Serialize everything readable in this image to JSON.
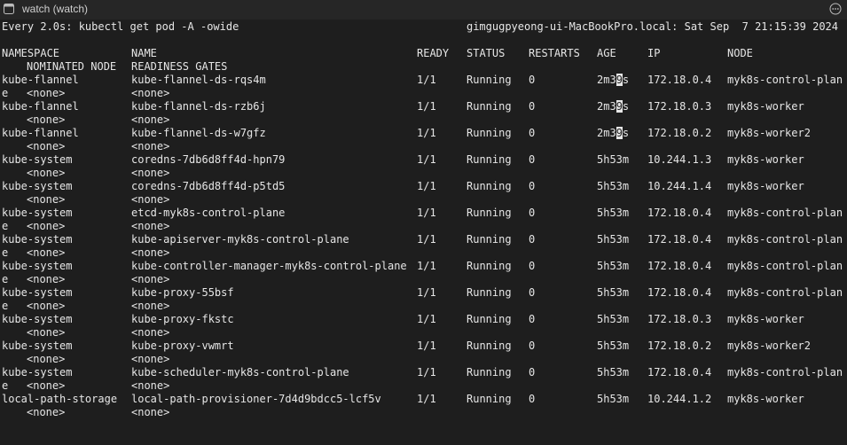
{
  "window": {
    "title": "watch (watch)"
  },
  "header": {
    "command": "Every 2.0s: kubectl get pod -A -owide",
    "host_time": "gimgugpyeong-ui-MacBookPro.local: Sat Sep  7 21:15:39 2024"
  },
  "columns": {
    "namespace": "NAMESPACE",
    "name": "NAME",
    "ready": "READY",
    "status": "STATUS",
    "restarts": "RESTARTS",
    "age": "AGE",
    "ip": "IP",
    "node": "NODE",
    "nominated_node": "NOMINATED NODE",
    "readiness_gates": "READINESS GATES"
  },
  "pods": [
    {
      "namespace": "kube-flannel",
      "name": "kube-flannel-ds-rqs4m",
      "ready": "1/1",
      "status": "Running",
      "restarts": "0",
      "age": "2m39s",
      "ip": "172.18.0.4",
      "node": "myk8s-control-plan",
      "wrap": "e",
      "nominated": "<none>",
      "gates": "<none>"
    },
    {
      "namespace": "kube-flannel",
      "name": "kube-flannel-ds-rzb6j",
      "ready": "1/1",
      "status": "Running",
      "restarts": "0",
      "age": "2m39s",
      "ip": "172.18.0.3",
      "node": "myk8s-worker",
      "wrap": "",
      "nominated": "<none>",
      "gates": "<none>"
    },
    {
      "namespace": "kube-flannel",
      "name": "kube-flannel-ds-w7gfz",
      "ready": "1/1",
      "status": "Running",
      "restarts": "0",
      "age": "2m39s",
      "ip": "172.18.0.2",
      "node": "myk8s-worker2",
      "wrap": "",
      "nominated": "<none>",
      "gates": "<none>"
    },
    {
      "namespace": "kube-system",
      "name": "coredns-7db6d8ff4d-hpn79",
      "ready": "1/1",
      "status": "Running",
      "restarts": "0",
      "age": "5h53m",
      "ip": "10.244.1.3",
      "node": "myk8s-worker",
      "wrap": "",
      "nominated": "<none>",
      "gates": "<none>"
    },
    {
      "namespace": "kube-system",
      "name": "coredns-7db6d8ff4d-p5td5",
      "ready": "1/1",
      "status": "Running",
      "restarts": "0",
      "age": "5h53m",
      "ip": "10.244.1.4",
      "node": "myk8s-worker",
      "wrap": "",
      "nominated": "<none>",
      "gates": "<none>"
    },
    {
      "namespace": "kube-system",
      "name": "etcd-myk8s-control-plane",
      "ready": "1/1",
      "status": "Running",
      "restarts": "0",
      "age": "5h53m",
      "ip": "172.18.0.4",
      "node": "myk8s-control-plan",
      "wrap": "e",
      "nominated": "<none>",
      "gates": "<none>"
    },
    {
      "namespace": "kube-system",
      "name": "kube-apiserver-myk8s-control-plane",
      "ready": "1/1",
      "status": "Running",
      "restarts": "0",
      "age": "5h53m",
      "ip": "172.18.0.4",
      "node": "myk8s-control-plan",
      "wrap": "e",
      "nominated": "<none>",
      "gates": "<none>"
    },
    {
      "namespace": "kube-system",
      "name": "kube-controller-manager-myk8s-control-plane",
      "ready": "1/1",
      "status": "Running",
      "restarts": "0",
      "age": "5h53m",
      "ip": "172.18.0.4",
      "node": "myk8s-control-plan",
      "wrap": "e",
      "nominated": "<none>",
      "gates": "<none>"
    },
    {
      "namespace": "kube-system",
      "name": "kube-proxy-55bsf",
      "ready": "1/1",
      "status": "Running",
      "restarts": "0",
      "age": "5h53m",
      "ip": "172.18.0.4",
      "node": "myk8s-control-plan",
      "wrap": "e",
      "nominated": "<none>",
      "gates": "<none>"
    },
    {
      "namespace": "kube-system",
      "name": "kube-proxy-fkstc",
      "ready": "1/1",
      "status": "Running",
      "restarts": "0",
      "age": "5h53m",
      "ip": "172.18.0.3",
      "node": "myk8s-worker",
      "wrap": "",
      "nominated": "<none>",
      "gates": "<none>"
    },
    {
      "namespace": "kube-system",
      "name": "kube-proxy-vwmrt",
      "ready": "1/1",
      "status": "Running",
      "restarts": "0",
      "age": "5h53m",
      "ip": "172.18.0.2",
      "node": "myk8s-worker2",
      "wrap": "",
      "nominated": "<none>",
      "gates": "<none>"
    },
    {
      "namespace": "kube-system",
      "name": "kube-scheduler-myk8s-control-plane",
      "ready": "1/1",
      "status": "Running",
      "restarts": "0",
      "age": "5h53m",
      "ip": "172.18.0.4",
      "node": "myk8s-control-plan",
      "wrap": "e",
      "nominated": "<none>",
      "gates": "<none>"
    },
    {
      "namespace": "local-path-storage",
      "name": "local-path-provisioner-7d4d9bdcc5-lcf5v",
      "ready": "1/1",
      "status": "Running",
      "restarts": "0",
      "age": "5h53m",
      "ip": "10.244.1.2",
      "node": "myk8s-worker",
      "wrap": "",
      "nominated": "<none>",
      "gates": "<none>"
    }
  ],
  "icons": {
    "window": "terminal-icon",
    "more": "more-options-icon"
  },
  "colors": {
    "background": "#1e1e1e",
    "text": "#e6e6e6",
    "titlebar": "#262626"
  }
}
